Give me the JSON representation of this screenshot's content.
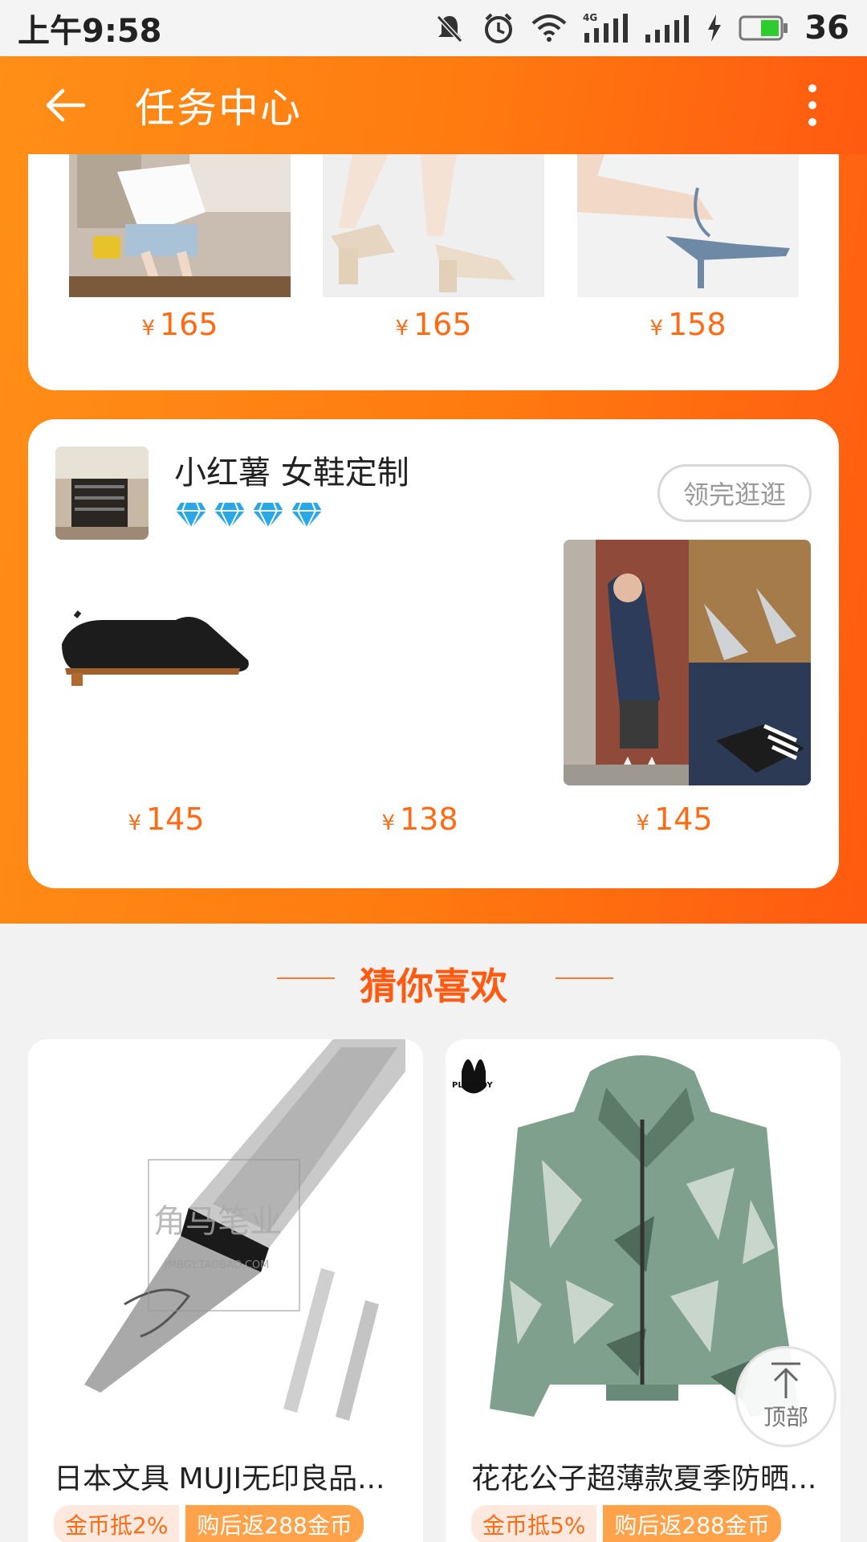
{
  "status_bar": {
    "time": "上午9:58",
    "battery": "36",
    "network": "4G"
  },
  "header": {
    "title": "任务中心",
    "back_icon": "arrow-left-icon",
    "more_icon": "more-vertical-icon"
  },
  "card1": {
    "products": [
      {
        "currency": "¥",
        "price": "165"
      },
      {
        "currency": "¥",
        "price": "165"
      },
      {
        "currency": "¥",
        "price": "158"
      }
    ]
  },
  "card2": {
    "shop_name": "小红薯 女鞋定制",
    "diamond_count": 4,
    "visit_button": "领完逛逛",
    "products": [
      {
        "currency": "¥",
        "price": "145"
      },
      {
        "currency": "¥",
        "price": "138"
      },
      {
        "currency": "¥",
        "price": "145"
      }
    ]
  },
  "guess": {
    "title": "猜你喜欢",
    "items": [
      {
        "title": "日本文具 MUJI无印良品...",
        "tag_discount": "金币抵2%",
        "tag_reward": "购后返288金币",
        "watermark": "角马笔业",
        "watermark_sub": "JMBGY.TAOBAO.COM"
      },
      {
        "title": "花花公子超薄款夏季防晒...",
        "tag_discount": "金币抵5%",
        "tag_reward": "购后返288金币",
        "brand": "PLAYBOY"
      }
    ]
  },
  "top_button": {
    "label": "顶部"
  },
  "colors": {
    "accent": "#ff7a10",
    "price": "#ff6a13",
    "diamond": "#29a8e8"
  }
}
